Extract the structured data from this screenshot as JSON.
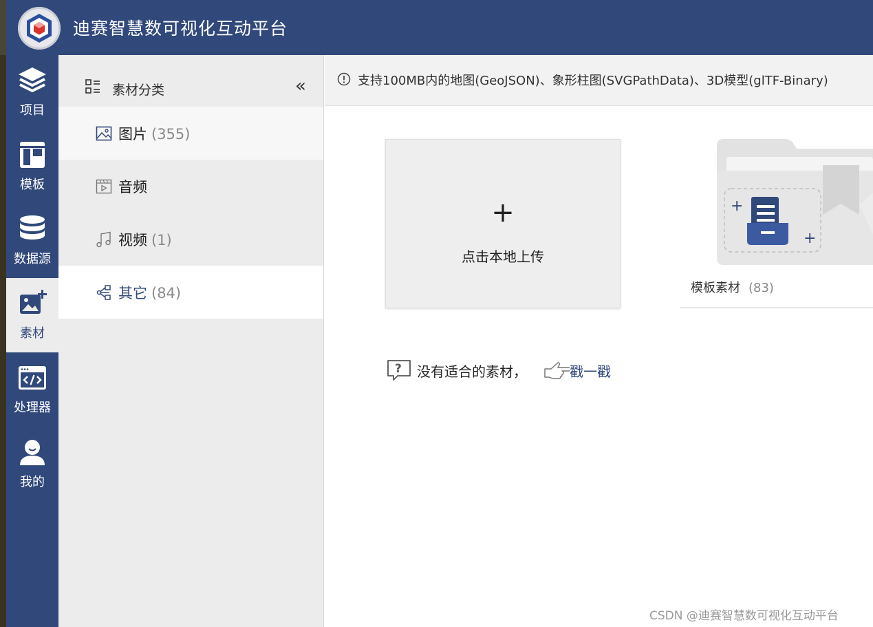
{
  "app": {
    "title": "迪赛智慧数可视化互动平台",
    "logo_icon": "cube-logo-icon",
    "colors": {
      "header": "#30487a",
      "active_bg": "#ececec",
      "accent": "#30487a"
    }
  },
  "rail": {
    "items": [
      {
        "label": "项目",
        "icon": "layers-icon",
        "active": false
      },
      {
        "label": "模板",
        "icon": "layout-icon",
        "active": false
      },
      {
        "label": "数据源",
        "icon": "database-icon",
        "active": false
      },
      {
        "label": "素材",
        "icon": "image-add-icon",
        "active": true
      },
      {
        "label": "处理器",
        "icon": "code-window-icon",
        "active": false
      },
      {
        "label": "我的",
        "icon": "user-icon",
        "active": false
      }
    ]
  },
  "categories": {
    "header": "素材分类",
    "collapse_label": "«",
    "items": [
      {
        "name": "图片",
        "count": "(355)",
        "icon": "image-icon"
      },
      {
        "name": "音频",
        "count": "",
        "icon": "video-icon"
      },
      {
        "name": "视频",
        "count": "(1)",
        "icon": "music-icon"
      },
      {
        "name": "其它",
        "count": "(84)",
        "icon": "share-node-icon",
        "selected": true
      }
    ]
  },
  "info_bar": {
    "text": "支持100MB内的地图(GeoJSON)、象形柱图(SVGPathData)、3D模型(glTF-Binary)"
  },
  "upload_card": {
    "plus": "+",
    "label": "点击本地上传"
  },
  "template_card": {
    "label": "模板素材",
    "count": "(83)"
  },
  "help": {
    "text": "没有适合的素材，",
    "link": "戳一戳"
  },
  "watermark": "CSDN @迪赛智慧数可视化互动平台"
}
